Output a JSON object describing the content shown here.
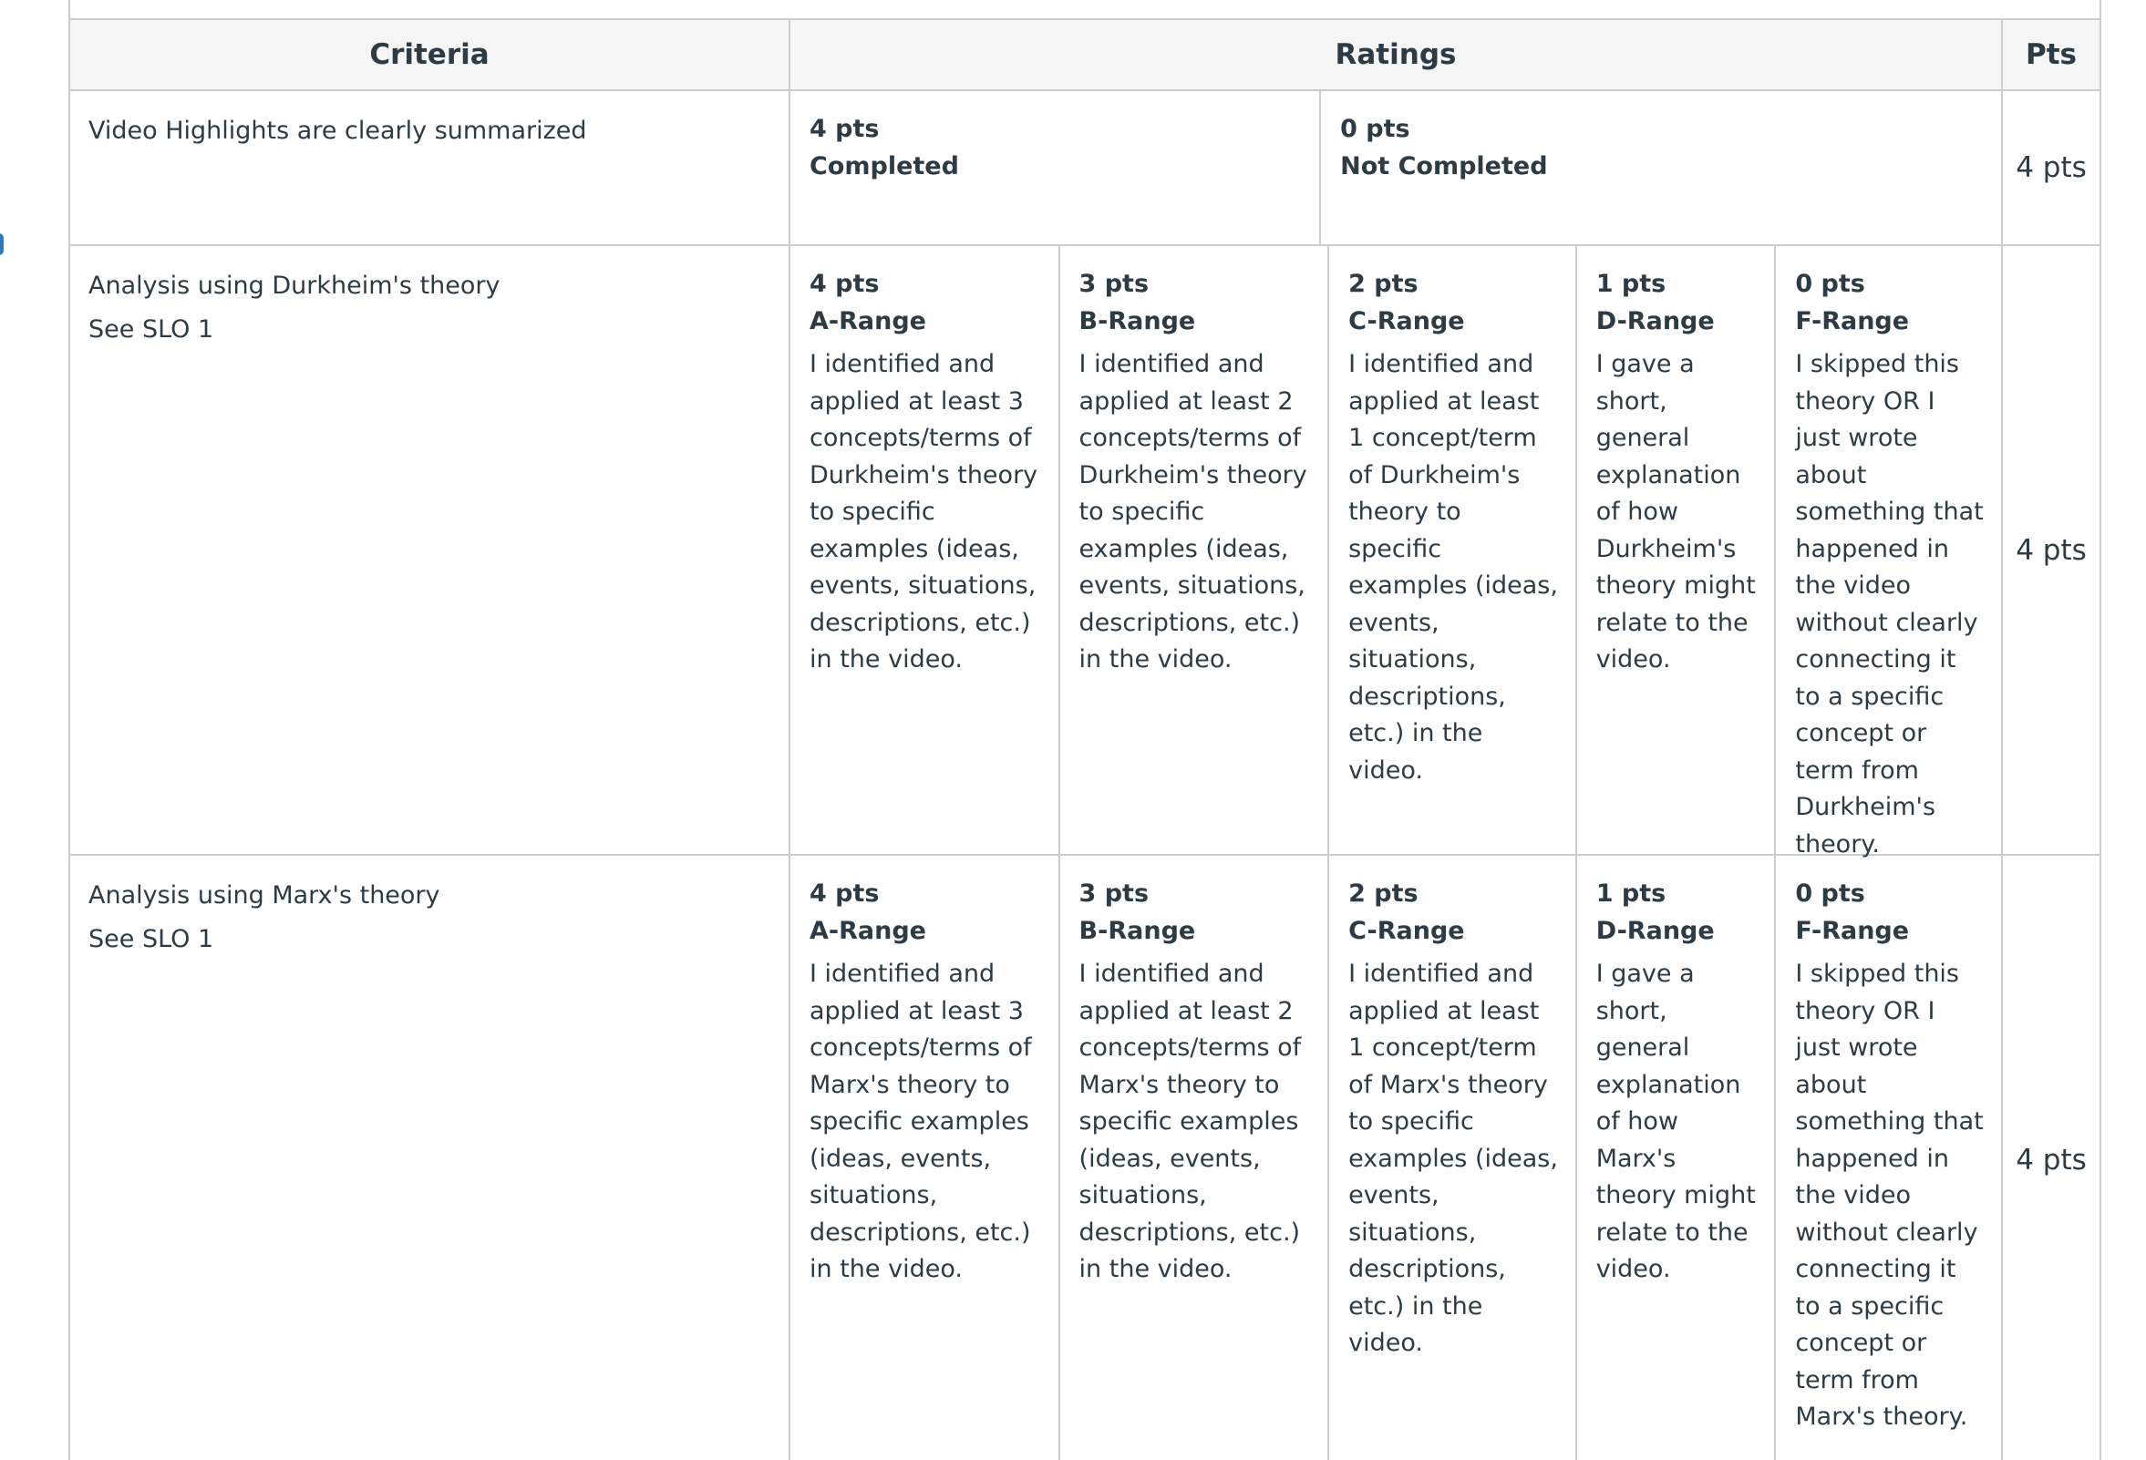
{
  "table": {
    "headers": {
      "criteria": "Criteria",
      "ratings": "Ratings",
      "pts": "Pts"
    },
    "rows": [
      {
        "criterion": "Video Highlights are clearly summarized",
        "note": "",
        "ratings": [
          {
            "pts": "4 pts",
            "name": "Completed",
            "desc": ""
          },
          {
            "pts": "0 pts",
            "name": "Not Completed",
            "desc": ""
          }
        ],
        "points": "4 pts"
      },
      {
        "criterion": "Analysis using Durkheim's theory",
        "note": "See SLO 1",
        "ratings": [
          {
            "pts": "4 pts",
            "name": "A-Range",
            "desc": "I identified and applied at least 3 concepts/terms of Durkheim's theory to specific examples (ideas, events, situations, descriptions, etc.) in the video."
          },
          {
            "pts": "3 pts",
            "name": "B-Range",
            "desc": "I identified and applied at least 2 concepts/terms of Durkheim's theory to specific examples (ideas, events, situations, descriptions, etc.) in the video."
          },
          {
            "pts": "2 pts",
            "name": "C-Range",
            "desc": "I identified and applied at least 1 concept/term of Durkheim's theory to specific examples (ideas, events, situations, descriptions, etc.) in the video."
          },
          {
            "pts": "1 pts",
            "name": "D-Range",
            "desc": "I gave a short, general explanation of how Durkheim's theory might relate to the video."
          },
          {
            "pts": "0 pts",
            "name": "F-Range",
            "desc": "I skipped this theory OR I just wrote about something that happened in the video without clearly connecting it to a specific concept or term from Durkheim's theory."
          }
        ],
        "points": "4 pts"
      },
      {
        "criterion": "Analysis using Marx's theory",
        "note": "See SLO 1",
        "ratings": [
          {
            "pts": "4 pts",
            "name": "A-Range",
            "desc": "I identified and applied at least 3 concepts/terms of Marx's theory to specific examples (ideas, events, situations, descriptions, etc.) in the video."
          },
          {
            "pts": "3 pts",
            "name": "B-Range",
            "desc": "I identified and applied at least 2 concepts/terms of Marx's theory to specific examples (ideas, events, situations, descriptions, etc.) in the video."
          },
          {
            "pts": "2 pts",
            "name": "C-Range",
            "desc": "I identified and applied at least 1 concept/term of Marx's theory to specific examples (ideas, events, situations, descriptions, etc.) in the video."
          },
          {
            "pts": "1 pts",
            "name": "D-Range",
            "desc": "I gave a short, general explanation of how Marx's theory might relate to the video."
          },
          {
            "pts": "0 pts",
            "name": "F-Range",
            "desc": "I skipped this theory OR I just wrote about something that happened in the video without clearly connecting it to a specific concept or term from Marx's theory."
          }
        ],
        "points": "4 pts"
      }
    ]
  }
}
